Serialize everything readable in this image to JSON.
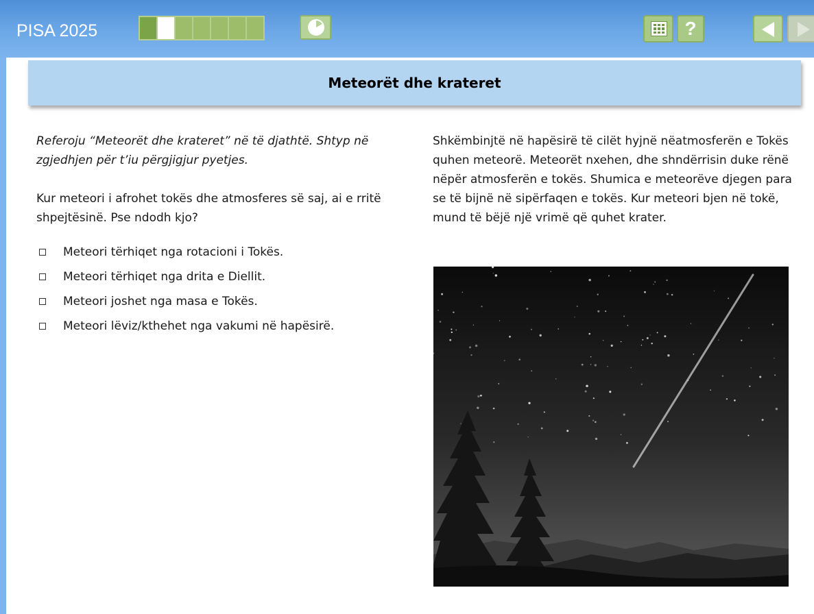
{
  "header": {
    "app_title": "PISA 2025",
    "progress": {
      "total_units": 7,
      "completed_units": 1,
      "current_unit": 2
    },
    "icons": {
      "timer": "clock-icon",
      "calculator": "calculator-icon",
      "help": "help-icon",
      "back": "back-arrow-icon",
      "next": "next-arrow-icon"
    },
    "help_label": "?"
  },
  "banner": {
    "title": "Meteorët dhe krateret"
  },
  "question": {
    "instruction": "Referoju “Meteorët dhe krateret” në të djathtë. Shtyp në zgjedhjen për t’iu përgjigjur pyetjes.",
    "prompt": "Kur meteori i afrohet tokës dhe atmosferes së saj, ai e rritë shpejtësinë. Pse ndodh kjo?",
    "options": [
      "Meteori tërhiqet nga rotacioni i Tokës.",
      "Meteori tërhiqet nga drita e Diellit.",
      "Meteori joshet nga masa e Tokës.",
      "Meteori lëviz/kthehet nga vakumi në hapësirë."
    ]
  },
  "stimulus": {
    "text": "Shkëmbinjtë në hapësirë të cilët hyjnë nëatmosferën e Tokës quhen meteorë. Meteorët nxehen, dhe shndërrisin duke rënë nëpër atmosferën e tokës. Shumica e meteorëve djegen para se të bijnë në sipërfaqen e tokës. Kur meteori bjen në tokë, mund të bëjë një vrimë që quhet krater."
  },
  "colors": {
    "topbar": "#6aa6e6",
    "banner": "#b4d5f2",
    "button_green": "#a9ca86",
    "progress_current": "#ffffff"
  }
}
